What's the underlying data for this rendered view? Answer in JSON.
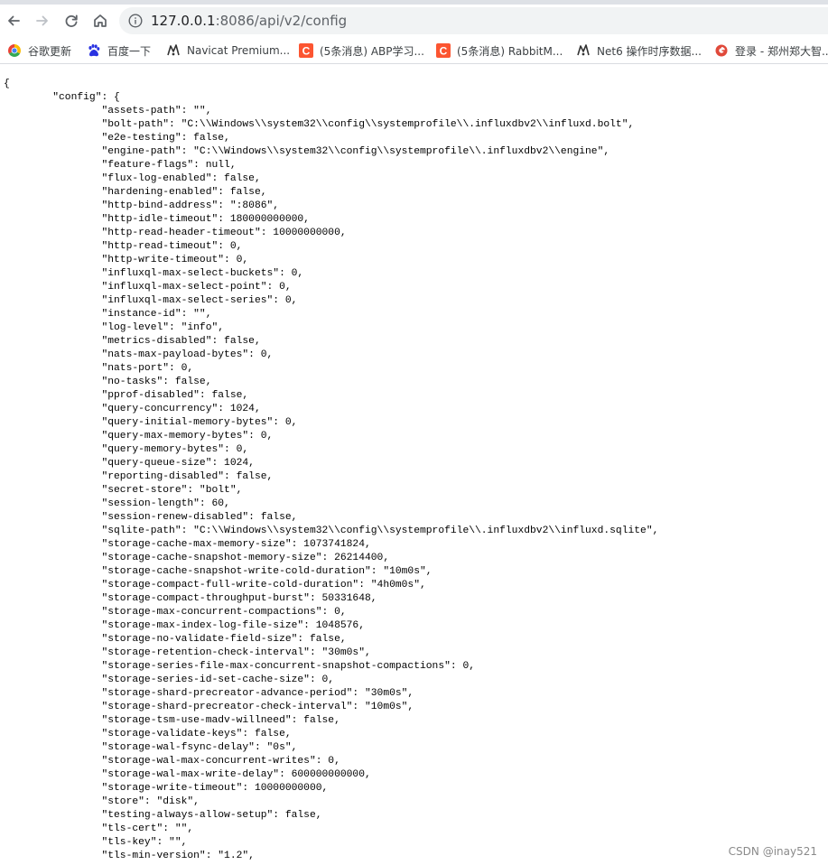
{
  "browser": {
    "url_host": "127.0.0.1",
    "url_rest": ":8086/api/v2/config"
  },
  "bookmarks": [
    {
      "label": "谷歌更新",
      "icon": "chrome-logo-icon"
    },
    {
      "label": "百度一下",
      "icon": "baidu-paw-icon"
    },
    {
      "label": "Navicat Premium...",
      "icon": "navicat-icon"
    },
    {
      "label": "(5条消息) ABP学习...",
      "icon": "csdn-c-icon"
    },
    {
      "label": "(5条消息) RabbitM...",
      "icon": "csdn-c-icon"
    },
    {
      "label": "Net6 操作时序数据...",
      "icon": "navicat-icon"
    },
    {
      "label": "登录 - 郑州郑大智...",
      "icon": "gear-logo-icon"
    }
  ],
  "json_text": "{\n\t\"config\": {\n\t\t\"assets-path\": \"\",\n\t\t\"bolt-path\": \"C:\\\\Windows\\\\system32\\\\config\\\\systemprofile\\\\.influxdbv2\\\\influxd.bolt\",\n\t\t\"e2e-testing\": false,\n\t\t\"engine-path\": \"C:\\\\Windows\\\\system32\\\\config\\\\systemprofile\\\\.influxdbv2\\\\engine\",\n\t\t\"feature-flags\": null,\n\t\t\"flux-log-enabled\": false,\n\t\t\"hardening-enabled\": false,\n\t\t\"http-bind-address\": \":8086\",\n\t\t\"http-idle-timeout\": 180000000000,\n\t\t\"http-read-header-timeout\": 10000000000,\n\t\t\"http-read-timeout\": 0,\n\t\t\"http-write-timeout\": 0,\n\t\t\"influxql-max-select-buckets\": 0,\n\t\t\"influxql-max-select-point\": 0,\n\t\t\"influxql-max-select-series\": 0,\n\t\t\"instance-id\": \"\",\n\t\t\"log-level\": \"info\",\n\t\t\"metrics-disabled\": false,\n\t\t\"nats-max-payload-bytes\": 0,\n\t\t\"nats-port\": 0,\n\t\t\"no-tasks\": false,\n\t\t\"pprof-disabled\": false,\n\t\t\"query-concurrency\": 1024,\n\t\t\"query-initial-memory-bytes\": 0,\n\t\t\"query-max-memory-bytes\": 0,\n\t\t\"query-memory-bytes\": 0,\n\t\t\"query-queue-size\": 1024,\n\t\t\"reporting-disabled\": false,\n\t\t\"secret-store\": \"bolt\",\n\t\t\"session-length\": 60,\n\t\t\"session-renew-disabled\": false,\n\t\t\"sqlite-path\": \"C:\\\\Windows\\\\system32\\\\config\\\\systemprofile\\\\.influxdbv2\\\\influxd.sqlite\",\n\t\t\"storage-cache-max-memory-size\": 1073741824,\n\t\t\"storage-cache-snapshot-memory-size\": 26214400,\n\t\t\"storage-cache-snapshot-write-cold-duration\": \"10m0s\",\n\t\t\"storage-compact-full-write-cold-duration\": \"4h0m0s\",\n\t\t\"storage-compact-throughput-burst\": 50331648,\n\t\t\"storage-max-concurrent-compactions\": 0,\n\t\t\"storage-max-index-log-file-size\": 1048576,\n\t\t\"storage-no-validate-field-size\": false,\n\t\t\"storage-retention-check-interval\": \"30m0s\",\n\t\t\"storage-series-file-max-concurrent-snapshot-compactions\": 0,\n\t\t\"storage-series-id-set-cache-size\": 0,\n\t\t\"storage-shard-precreator-advance-period\": \"30m0s\",\n\t\t\"storage-shard-precreator-check-interval\": \"10m0s\",\n\t\t\"storage-tsm-use-madv-willneed\": false,\n\t\t\"storage-validate-keys\": false,\n\t\t\"storage-wal-fsync-delay\": \"0s\",\n\t\t\"storage-wal-max-concurrent-writes\": 0,\n\t\t\"storage-wal-max-write-delay\": 600000000000,\n\t\t\"storage-write-timeout\": 10000000000,\n\t\t\"store\": \"disk\",\n\t\t\"testing-always-allow-setup\": false,\n\t\t\"tls-cert\": \"\",\n\t\t\"tls-key\": \"\",\n\t\t\"tls-min-version\": \"1.2\",",
  "watermark": "CSDN @inay521"
}
